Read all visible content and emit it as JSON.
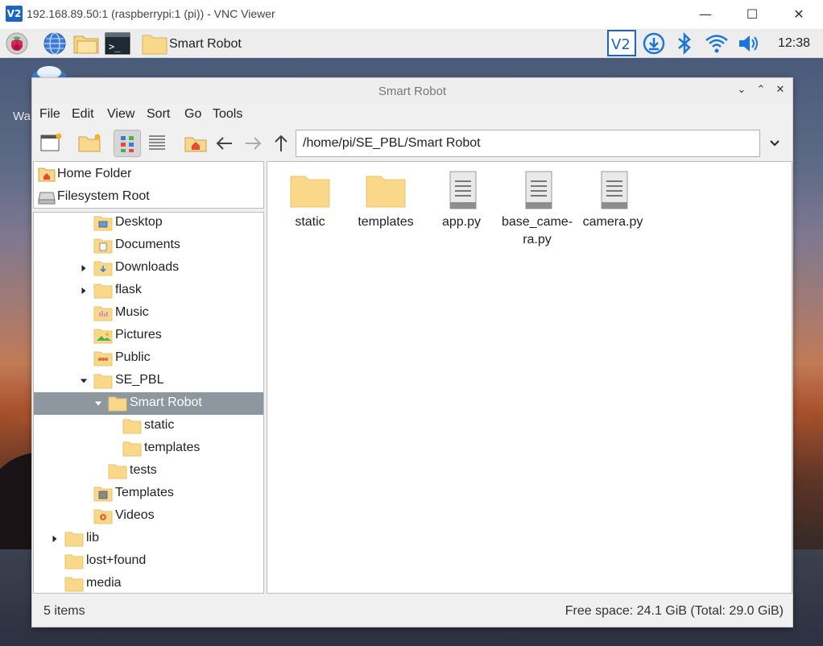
{
  "vnc": {
    "title": "192.168.89.50:1 (raspberrypi:1 (pi)) - VNC Viewer",
    "logo": "V2",
    "minimize": "—",
    "maximize": "☐",
    "close": "✕"
  },
  "panel": {
    "task_label": "Smart Robot",
    "clock": "12:38",
    "tray_icons": [
      "vnc-icon",
      "download-icon",
      "bluetooth-icon",
      "wifi-icon",
      "volume-icon"
    ],
    "launchers": [
      "raspberry-menu-icon",
      "web-browser-icon",
      "file-manager-icon",
      "terminal-icon"
    ]
  },
  "desktop": {
    "partial_label": "Wa"
  },
  "window": {
    "title": "Smart Robot",
    "controls": {
      "minimize": "⌄",
      "maximize": "⌃",
      "close": "✕"
    },
    "menu": [
      "File",
      "Edit",
      "View",
      "Sort",
      "Go",
      "Tools"
    ],
    "path": "/home/pi/SE_PBL/Smart Robot",
    "places": [
      "Home Folder",
      "Filesystem Root"
    ],
    "tree": [
      {
        "label": "Desktop",
        "expander": "none",
        "icon": "desktop"
      },
      {
        "label": "Documents",
        "expander": "none",
        "icon": "documents"
      },
      {
        "label": "Downloads",
        "expander": "collapsed",
        "icon": "downloads"
      },
      {
        "label": "flask",
        "expander": "collapsed",
        "icon": "folder"
      },
      {
        "label": "Music",
        "expander": "none",
        "icon": "music"
      },
      {
        "label": "Pictures",
        "expander": "none",
        "icon": "pictures"
      },
      {
        "label": "Public",
        "expander": "none",
        "icon": "public"
      },
      {
        "label": "SE_PBL",
        "expander": "expanded",
        "icon": "folder"
      },
      {
        "label": "Smart Robot",
        "expander": "expanded",
        "icon": "folder",
        "selected": true
      },
      {
        "label": "static",
        "expander": "none",
        "icon": "folder"
      },
      {
        "label": "templates",
        "expander": "none",
        "icon": "folder"
      },
      {
        "label": "tests",
        "expander": "none",
        "icon": "folder"
      },
      {
        "label": "Templates",
        "expander": "none",
        "icon": "templates"
      },
      {
        "label": "Videos",
        "expander": "none",
        "icon": "videos"
      },
      {
        "label": "lib",
        "expander": "collapsed",
        "icon": "folder"
      },
      {
        "label": "lost+found",
        "expander": "none",
        "icon": "folder"
      },
      {
        "label": "media",
        "expander": "none",
        "icon": "folder"
      }
    ],
    "files": [
      {
        "label": "static",
        "type": "folder"
      },
      {
        "label": "templates",
        "type": "folder"
      },
      {
        "label": "app.py",
        "type": "file"
      },
      {
        "label": "base_came-\nra.py",
        "type": "file"
      },
      {
        "label": "camera.py",
        "type": "file"
      }
    ],
    "status_left": "5 items",
    "status_right": "Free space: 24.1 GiB (Total: 29.0 GiB)"
  },
  "colors": {
    "selection": "#8d979f",
    "folder": "#f9d88a",
    "folder_dark": "#e8c36c",
    "vnc_blue": "#1c65c7"
  }
}
